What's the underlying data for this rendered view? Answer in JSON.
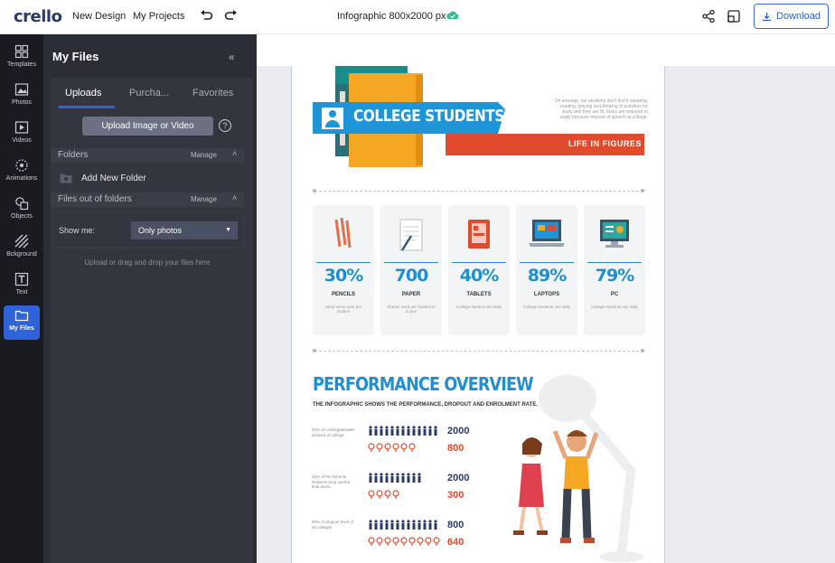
{
  "topbar": {
    "logo": "crello",
    "new_design": "New Design",
    "my_projects": "My Projects",
    "document_title": "Infographic 800x2000 px",
    "download": "Download"
  },
  "rail": {
    "items": [
      {
        "label": "Templates",
        "icon": "templates-icon"
      },
      {
        "label": "Photos",
        "icon": "photos-icon"
      },
      {
        "label": "Videos",
        "icon": "videos-icon"
      },
      {
        "label": "Animations",
        "icon": "animations-icon"
      },
      {
        "label": "Objects",
        "icon": "objects-icon"
      },
      {
        "label": "Bckground",
        "icon": "background-icon"
      },
      {
        "label": "Text",
        "icon": "text-icon"
      },
      {
        "label": "My Files",
        "icon": "folder-icon",
        "active": true
      }
    ]
  },
  "panel": {
    "title": "My Files",
    "tabs": [
      "Uploads",
      "Purcha...",
      "Favorites"
    ],
    "upload_button": "Upload Image or Video",
    "folders_label": "Folders",
    "manage": "Manage",
    "add_folder": "Add New Folder",
    "files_out_label": "Files out of folders",
    "show_me_label": "Show me:",
    "show_me_value": "Only photos",
    "drop_hint": "Upload or drag and drop your files here"
  },
  "infographic": {
    "banner_title": "COLLEGE STUDENTS",
    "banner_subtitle": "LIFE IN FIGURES",
    "blurb": "On average, our students don't find it sleeping, reading, playing and thinking of activities for study and they are fit. Many are required to study because interest of speech at college.",
    "stats": [
      {
        "pct": "30%",
        "label": "PENCILS",
        "sub": "Used every year per student"
      },
      {
        "pct": "700",
        "label": "PAPER",
        "sub": "Sheets used per student in a year"
      },
      {
        "pct": "40%",
        "label": "TABLETS",
        "sub": "College student use daily"
      },
      {
        "pct": "89%",
        "label": "LAPTOPS",
        "sub": "College students use daily"
      },
      {
        "pct": "79%",
        "label": "PC",
        "sub": "College students use daily"
      }
    ],
    "perf_title": "PERFORMANCE OVERVIEW",
    "perf_subtitle": "THE INFOGRAPHIC SHOWS THE PERFORMANCE, DROPOUT AND ENROLMENT RATE.",
    "rows": [
      {
        "label": "40% of Undergraduates dropout of college",
        "blue": "2000",
        "red": "800"
      },
      {
        "label": "15% of the full-time students drop out the final exam",
        "blue": "2000",
        "red": "300"
      },
      {
        "label": "80% of dropout level of all colleges",
        "blue": "800",
        "red": "640"
      }
    ]
  },
  "colors": {
    "brand_blue": "#1f8fd1",
    "accent_red": "#e24a2d",
    "active_blue": "#2f63d9",
    "panel_dark": "#2b2e36"
  }
}
